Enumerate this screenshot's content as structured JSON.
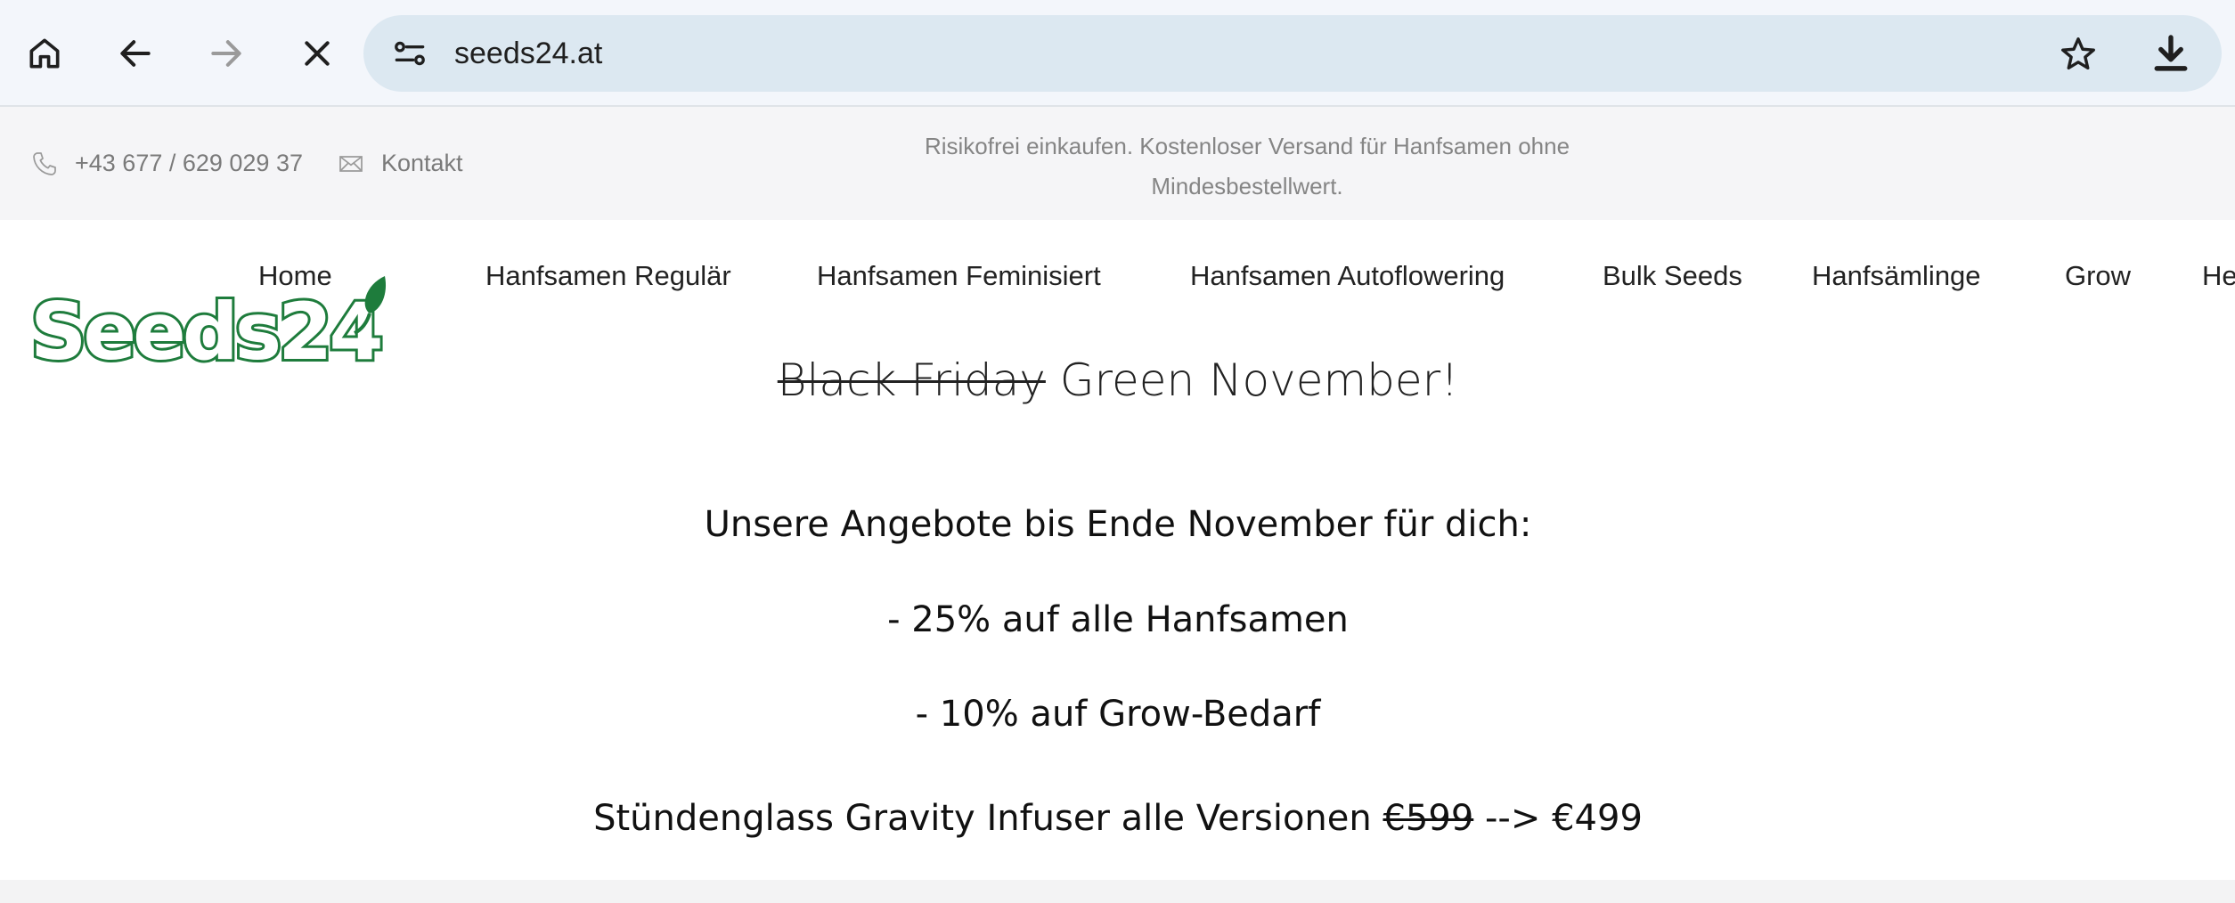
{
  "browser": {
    "url": "seeds24.at",
    "icons": {
      "home": "home-icon",
      "back": "back-arrow-icon",
      "forward": "forward-arrow-icon",
      "stop": "close-icon",
      "site_info": "tune-icon",
      "bookmark": "star-icon",
      "download": "download-icon"
    }
  },
  "topbar": {
    "phone": "+43 677 / 629 029 37",
    "contact_label": "Kontakt",
    "notice_line1": "Risikofrei einkaufen. Kostenloser Versand für Hanfsamen ohne",
    "notice_line2": "Mindesbestellwert."
  },
  "logo": {
    "text": "Seeds24"
  },
  "menu": {
    "items": [
      "Home",
      "Hanfsamen Regulär",
      "Hanfsamen Feminisiert",
      "Hanfsamen Autoflowering",
      "Bulk Seeds",
      "Hanfsämlinge",
      "Grow",
      "He"
    ]
  },
  "promo": {
    "title_struck": "Black Friday",
    "title_rest": "Green November!",
    "intro": "Unsere Angebote bis Ende November für dich:",
    "offer1": "- 25% auf alle Hanfsamen",
    "offer2": "- 10% auf Grow-Bedarf",
    "product_prefix": "Stündenglass Gravity Infuser alle Versionen",
    "old_price": "€599",
    "arrow": "-->",
    "new_price": "€499"
  },
  "colors": {
    "brand_green": "#1e7c3c",
    "chrome_bg": "#f3f6fb",
    "omnibox_bg": "#dce8f1"
  }
}
